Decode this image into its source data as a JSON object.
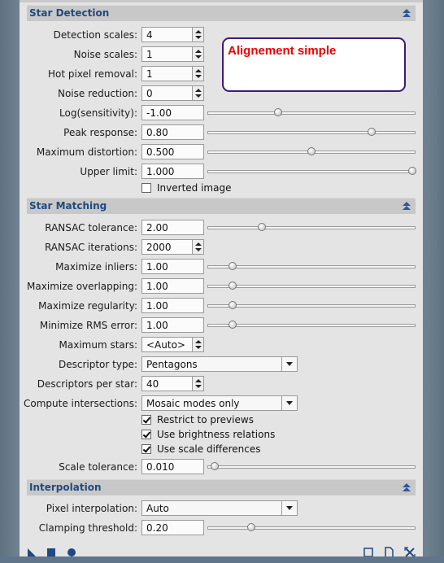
{
  "star_detection": {
    "title": "Star Detection",
    "detection_scales": {
      "label": "Detection scales:",
      "value": "4"
    },
    "noise_scales": {
      "label": "Noise scales:",
      "value": "1"
    },
    "hot_pixel_removal": {
      "label": "Hot pixel removal:",
      "value": "1"
    },
    "noise_reduction": {
      "label": "Noise reduction:",
      "value": "0"
    },
    "log_sensitivity": {
      "label": "Log(sensitivity):",
      "value": "-1.00",
      "slider": 0.34
    },
    "peak_response": {
      "label": "Peak response:",
      "value": "0.80",
      "slider": 0.79
    },
    "maximum_distortion": {
      "label": "Maximum distortion:",
      "value": "0.500",
      "slider": 0.5
    },
    "upper_limit": {
      "label": "Upper limit:",
      "value": "1.000",
      "slider": 0.99
    },
    "inverted_image": {
      "label": "Inverted image",
      "checked": false
    }
  },
  "annotation": {
    "text": "Alignement simple",
    "color": "#e00000"
  },
  "star_matching": {
    "title": "Star Matching",
    "ransac_tolerance": {
      "label": "RANSAC tolerance:",
      "value": "2.00",
      "slider": 0.26
    },
    "ransac_iterations": {
      "label": "RANSAC iterations:",
      "value": "2000"
    },
    "maximize_inliers": {
      "label": "Maximize inliers:",
      "value": "1.00",
      "slider": 0.12
    },
    "maximize_overlapping": {
      "label": "Maximize overlapping:",
      "value": "1.00",
      "slider": 0.12
    },
    "maximize_regularity": {
      "label": "Maximize regularity:",
      "value": "1.00",
      "slider": 0.12
    },
    "minimize_rms_error": {
      "label": "Minimize RMS error:",
      "value": "1.00",
      "slider": 0.12
    },
    "maximum_stars": {
      "label": "Maximum stars:",
      "value": "<Auto>"
    },
    "descriptor_type": {
      "label": "Descriptor type:",
      "value": "Pentagons"
    },
    "descriptors_per_star": {
      "label": "Descriptors per star:",
      "value": "40"
    },
    "compute_intersections": {
      "label": "Compute intersections:",
      "value": "Mosaic modes only"
    },
    "restrict_to_previews": {
      "label": "Restrict to previews",
      "checked": true
    },
    "use_brightness_relations": {
      "label": "Use brightness relations",
      "checked": true
    },
    "use_scale_differences": {
      "label": "Use scale differences",
      "checked": true
    },
    "scale_tolerance": {
      "label": "Scale tolerance:",
      "value": "0.010",
      "slider": 0.03
    }
  },
  "interpolation": {
    "title": "Interpolation",
    "pixel_interpolation": {
      "label": "Pixel interpolation:",
      "value": "Auto"
    },
    "clamping_threshold": {
      "label": "Clamping threshold:",
      "value": "0.20",
      "slider": 0.21
    }
  },
  "toolbar": {
    "new_instance": "new-instance-icon",
    "apply_global": "apply-global-icon",
    "apply": "apply-icon",
    "preview": "preview-icon",
    "reset": "reset-icon",
    "close": "close-icon"
  },
  "colors": {
    "section_title": "#1f4a80",
    "panel": "#e4e4e4",
    "section_bg": "#c8c8c8"
  }
}
